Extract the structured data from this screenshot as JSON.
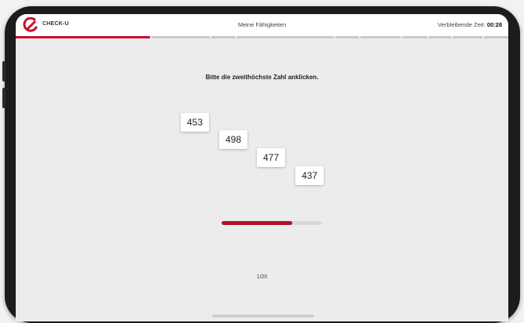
{
  "header": {
    "brand": "CHECK-U",
    "title": "Meine Fähigkeiten",
    "timer_label": "Verbleibende Zeit:",
    "timer_value": "00:28",
    "accent_color": "#c8102e"
  },
  "task": {
    "instruction": "Bitte die zweithöchste Zahl anklicken.",
    "numbers": [
      "453",
      "498",
      "477",
      "437"
    ]
  },
  "progress": {
    "fraction": 0.7
  },
  "footer": {
    "counter": "1/20"
  },
  "icons": {
    "logo": "check-u-logo-icon"
  }
}
